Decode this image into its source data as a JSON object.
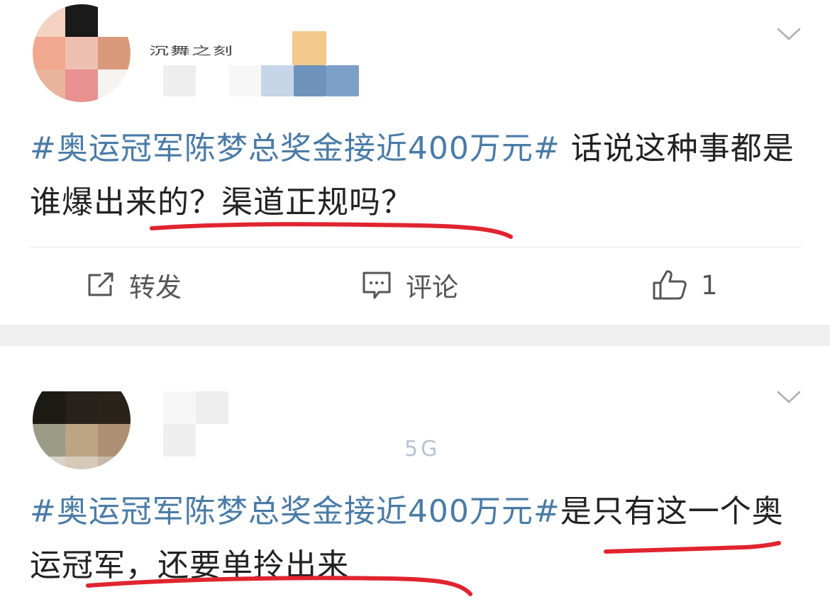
{
  "posts": [
    {
      "partial_name": "沉舞之刻",
      "content_topic": "#奥运冠军陈梦总奖金接近400万元#",
      "content_text": " 话说这种事都是谁爆出来的？渠道正规吗？",
      "actions": {
        "repost_label": "转发",
        "comment_label": "评论",
        "like_count": "1"
      }
    },
    {
      "partial_meta": "5G",
      "content_topic": "#奥运冠军陈梦总奖金接近400万元#",
      "content_text": "是只有这一个奥运冠军，还要单拎出来"
    }
  ],
  "colors": {
    "topic": "#4a7ba6",
    "text": "#222222",
    "underline": "#e0242f",
    "separator": "#efefef"
  },
  "icons": [
    "chevron-down-icon",
    "repost-icon",
    "comment-icon",
    "thumbs-up-icon"
  ]
}
